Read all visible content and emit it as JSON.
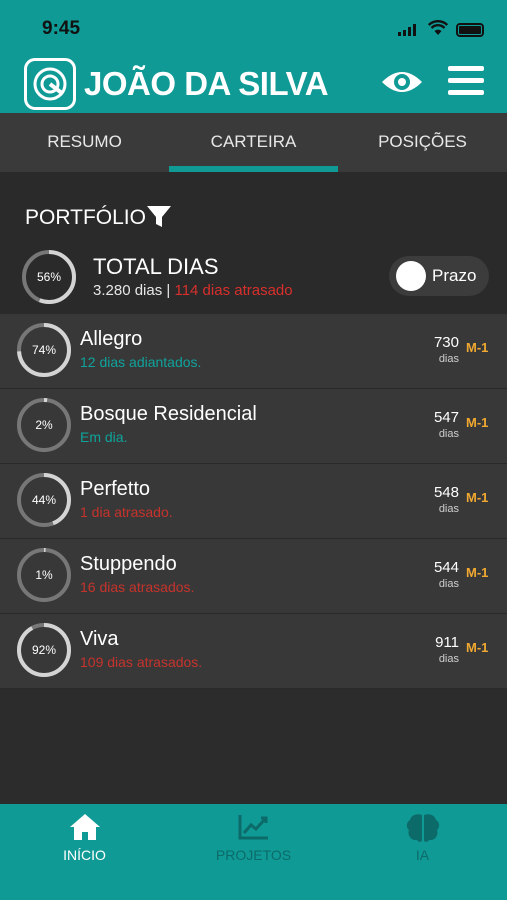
{
  "status_bar": {
    "time": "9:45"
  },
  "app_bar": {
    "title": "JOÃO DA SILVA",
    "icons": [
      "logo-icon",
      "eye-icon",
      "menu-icon"
    ]
  },
  "tabs": [
    {
      "label": "RESUMO",
      "active": false
    },
    {
      "label": "CARTEIRA",
      "active": true
    },
    {
      "label": "POSIÇÕES",
      "active": false
    }
  ],
  "portfolio": {
    "title": "PORTFÓLIO",
    "total": {
      "percent": 56,
      "percent_label": "56%",
      "title": "TOTAL DIAS",
      "days": "3.280 dias",
      "separator": " | ",
      "late": "114 dias atrasado"
    },
    "toggle_label": "Prazo"
  },
  "projects": [
    {
      "percent": 74,
      "percent_label": "74%",
      "name": "Allegro",
      "status": "12 dias adiantados.",
      "status_type": "green",
      "days": "730",
      "days_unit": "dias",
      "tag": "M-1"
    },
    {
      "percent": 2,
      "percent_label": "2%",
      "name": "Bosque Residencial",
      "status": "Em dia.",
      "status_type": "green",
      "days": "547",
      "days_unit": "dias",
      "tag": "M-1"
    },
    {
      "percent": 44,
      "percent_label": "44%",
      "name": "Perfetto",
      "status": "1 dia atrasado.",
      "status_type": "red",
      "days": "548",
      "days_unit": "dias",
      "tag": "M-1"
    },
    {
      "percent": 1,
      "percent_label": "1%",
      "name": "Stuppendo",
      "status": "16 dias atrasados.",
      "status_type": "red",
      "days": "544",
      "days_unit": "dias",
      "tag": "M-1"
    },
    {
      "percent": 92,
      "percent_label": "92%",
      "name": "Viva",
      "status": "109 dias atrasados.",
      "status_type": "red",
      "days": "911",
      "days_unit": "dias",
      "tag": "M-1"
    }
  ],
  "bottom_nav": [
    {
      "label": "INÍCIO",
      "icon": "home-icon",
      "active": true
    },
    {
      "label": "PROJETOS",
      "icon": "chart-icon",
      "active": false
    },
    {
      "label": "IA",
      "icon": "brain-icon",
      "active": false
    }
  ],
  "colors": {
    "accent": "#0f9a96",
    "late": "#d7302c",
    "ahead": "#0fa39c",
    "tag": "#f0a830"
  }
}
